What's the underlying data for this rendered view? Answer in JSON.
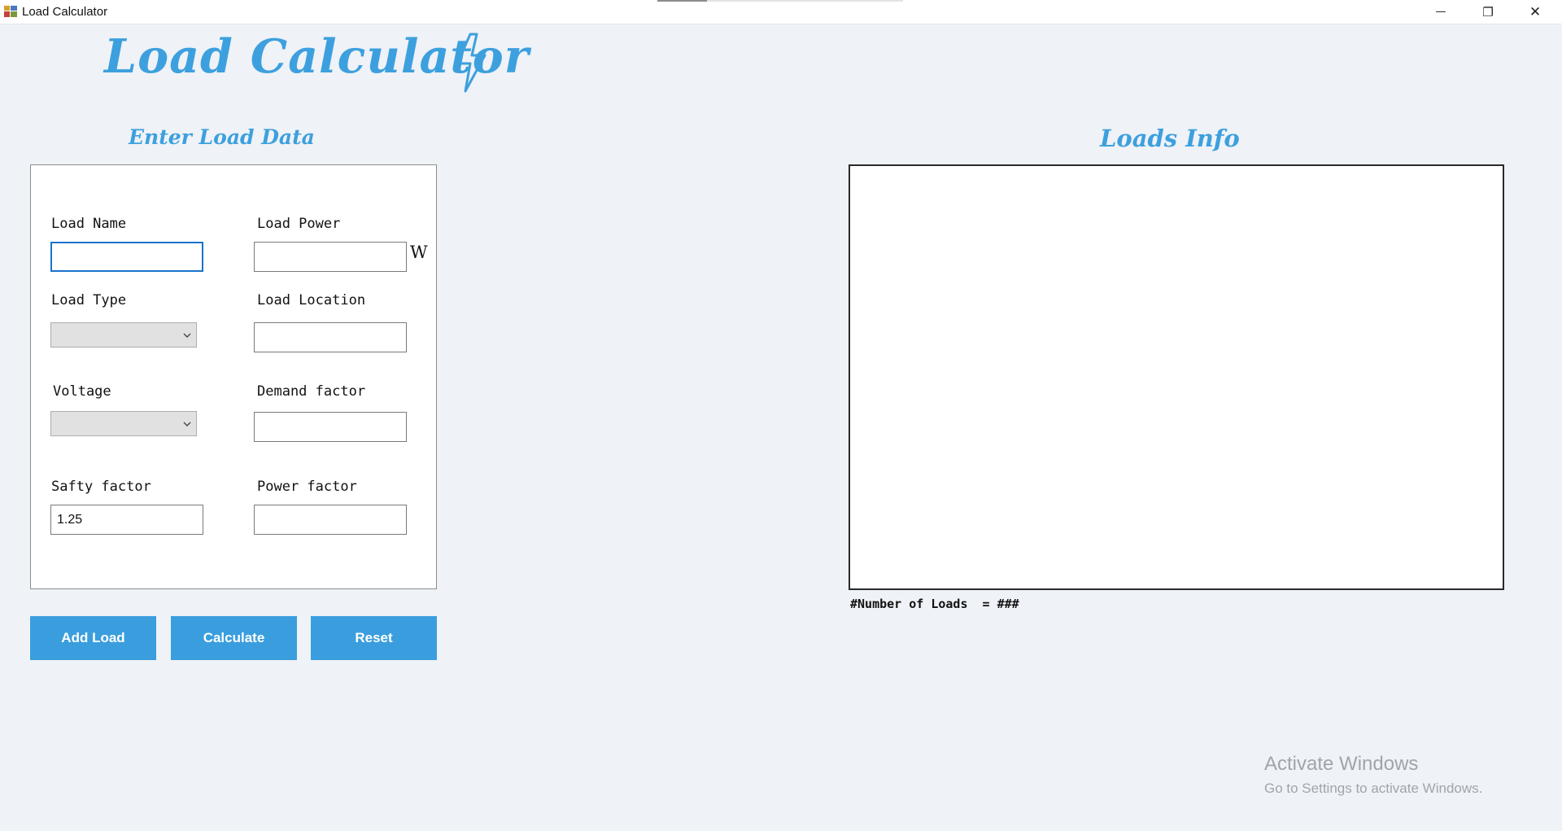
{
  "window": {
    "title": "Load Calculator",
    "minimize_glyph": "—",
    "restore_glyph": "❐",
    "close_glyph": "✕"
  },
  "header": {
    "app_title": "Load Calculator",
    "logo_icon": "lightning-bolt-icon"
  },
  "form": {
    "section_title": "Enter Load Data",
    "load_name": {
      "label": "Load Name",
      "value": ""
    },
    "load_power": {
      "label": "Load Power",
      "value": "",
      "unit": "W"
    },
    "load_type": {
      "label": "Load Type",
      "selected": ""
    },
    "load_location": {
      "label": "Load Location",
      "value": ""
    },
    "voltage": {
      "label": "Voltage",
      "selected": ""
    },
    "demand_factor": {
      "label": "Demand factor",
      "value": ""
    },
    "safety_factor": {
      "label": "Safty factor",
      "value": "1.25"
    },
    "power_factor": {
      "label": "Power factor",
      "value": ""
    }
  },
  "actions": {
    "add_load": "Add Load",
    "calculate": "Calculate",
    "reset": "Reset"
  },
  "loads_info": {
    "section_title": "Loads Info",
    "count_label": "#Number of Loads  = ###"
  },
  "watermark": {
    "title": "Activate Windows",
    "subtitle": "Go to Settings to activate Windows."
  },
  "colors": {
    "accent": "#3da0de",
    "button": "#3a9ede",
    "background": "#eff2f7"
  }
}
